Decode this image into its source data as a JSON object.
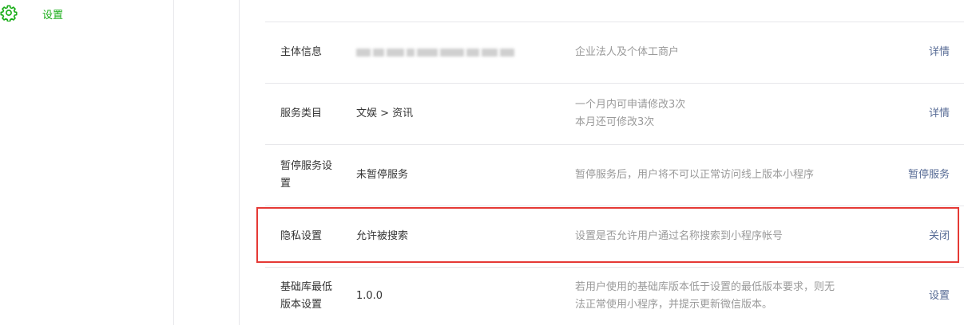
{
  "sidebar": {
    "settings_label": "设置",
    "settings_icon": "gear-icon",
    "accent_color": "#1aad19"
  },
  "rows": [
    {
      "label": "主体信息",
      "value": "",
      "value_redacted": true,
      "desc": [
        "企业法人及个体工商户"
      ],
      "action": "详情"
    },
    {
      "label": "服务类目",
      "value": "文娱 > 资讯",
      "desc": [
        "一个月内可申请修改3次",
        "本月还可修改3次"
      ],
      "action": "详情"
    },
    {
      "label": [
        "暂停服务设",
        "置"
      ],
      "value": "未暂停服务",
      "desc": [
        "暂停服务后，用户将不可以正常访问线上版本小程序"
      ],
      "action": "暂停服务"
    },
    {
      "label": "隐私设置",
      "value": "允许被搜索",
      "desc": [
        "设置是否允许用户通过名称搜索到小程序帐号"
      ],
      "action": "关闭",
      "highlighted": true
    },
    {
      "label": [
        "基础库最低",
        "版本设置"
      ],
      "value": "1.0.0",
      "desc": [
        "若用户使用的基础库版本低于设置的最低版本要求，则无",
        "法正常使用小程序，并提示更新微信版本。"
      ],
      "action": "设置"
    }
  ],
  "colors": {
    "link": "#576b95",
    "highlight_border": "#e53935",
    "desc_text": "#9a9a9a"
  }
}
